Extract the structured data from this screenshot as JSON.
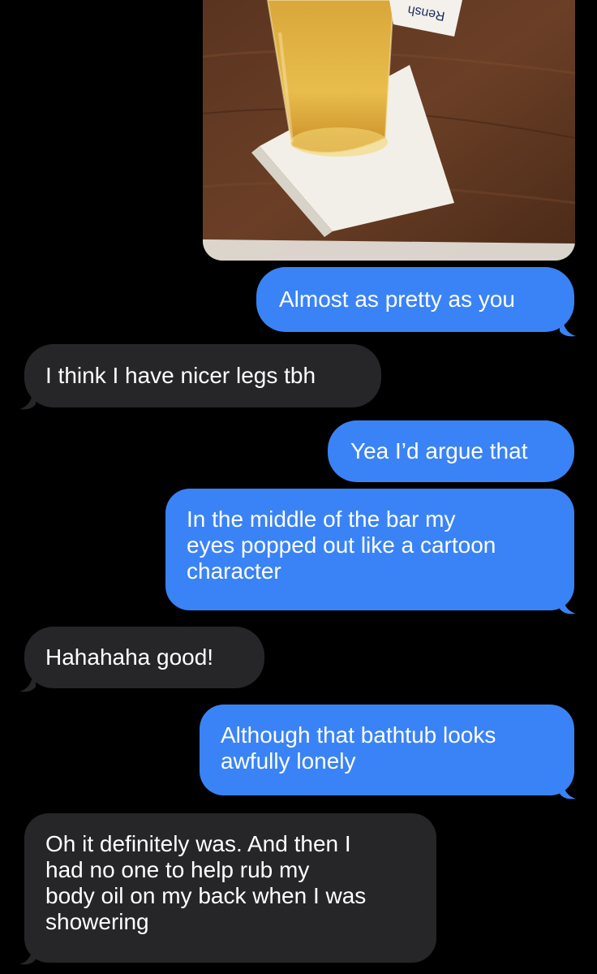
{
  "photo": {
    "coaster_text": "Rensh"
  },
  "messages": [
    {
      "direction": "sent",
      "lines": [
        "Almost as pretty as you"
      ]
    },
    {
      "direction": "received",
      "lines": [
        "I think I have nicer legs tbh"
      ]
    },
    {
      "direction": "sent",
      "lines": [
        "Yea I’d argue that"
      ]
    },
    {
      "direction": "sent",
      "lines": [
        "In the middle of the bar my",
        "eyes popped out like a cartoon",
        "character"
      ]
    },
    {
      "direction": "received",
      "lines": [
        "Hahahaha good!"
      ]
    },
    {
      "direction": "sent",
      "lines": [
        "Although that bathtub looks",
        "awfully lonely"
      ]
    },
    {
      "direction": "received",
      "lines": [
        "Oh it definitely was. And then I",
        "had no one to help rub my",
        "body oil on my back when I was",
        "showering"
      ]
    }
  ],
  "colors": {
    "sent_bubble": "#3a83f6",
    "received_bubble": "#262628",
    "background": "#000000",
    "text": "#ffffff"
  }
}
